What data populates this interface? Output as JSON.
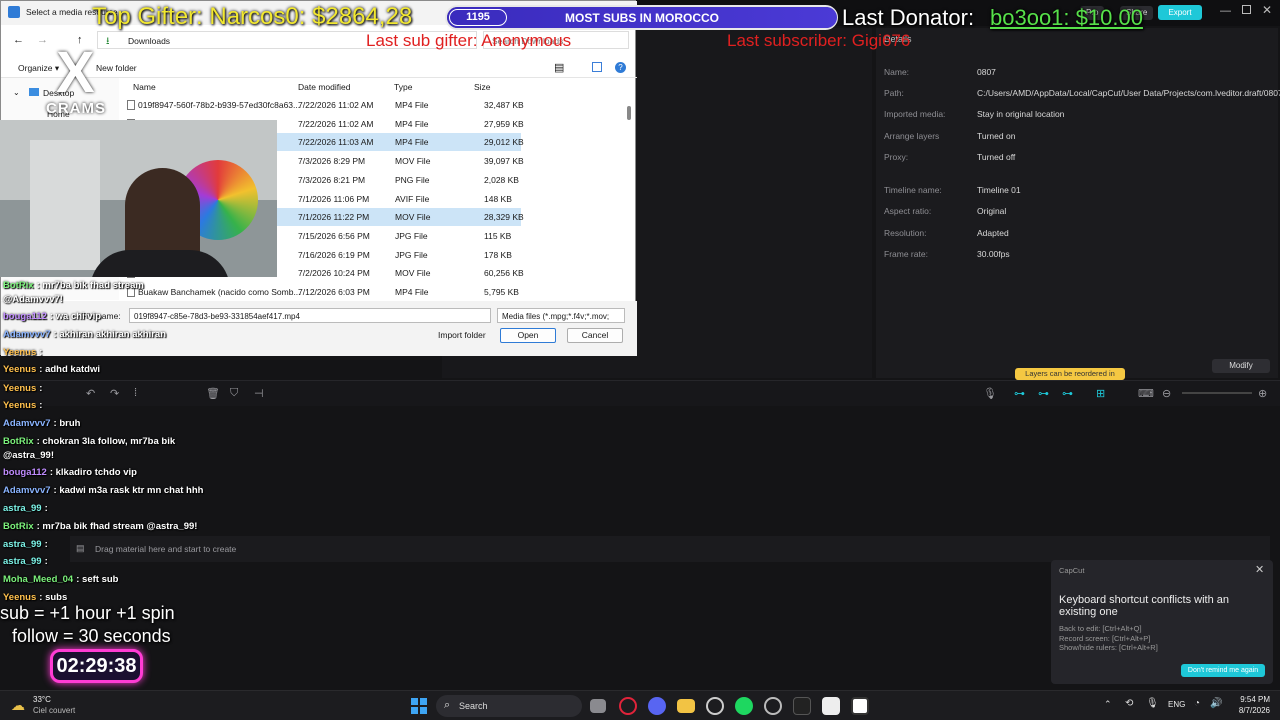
{
  "overlay": {
    "top_gifter": "Top Gifter: Narcos0: $2864,28",
    "goal_count": "1195",
    "goal_text": "MOST SUBS IN MOROCCO",
    "last_donator_label": "Last Donator:",
    "last_donator_value": "bo3oo1: $10.00",
    "last_sub_gifter": "Last sub gifter: Anonymous",
    "last_subscriber": "Last subscriber: Gigi676",
    "rules_line1": "sub  = +1 hour +1 spin",
    "rules_line2": "follow = 30 seconds",
    "timer": "02:29:38",
    "logo_text": "CRAMS"
  },
  "capcut": {
    "pro": "Pro",
    "share": "Share",
    "export": "Export",
    "details": "Details",
    "props": [
      {
        "label": "Name:",
        "value": "0807"
      },
      {
        "label": "Path:",
        "value": "C:/Users/AMD/AppData/Local/CapCut/User Data/Projects/com.lveditor.draft/0807"
      },
      {
        "label": "Imported media:",
        "value": "Stay in original location"
      },
      {
        "label": "Arrange layers",
        "value": "Turned on"
      },
      {
        "label": "Proxy:",
        "value": "Turned off"
      },
      {
        "label": "Timeline name:",
        "value": "Timeline 01"
      },
      {
        "label": "Aspect ratio:",
        "value": "Original"
      },
      {
        "label": "Resolution:",
        "value": "Adapted"
      },
      {
        "label": "Frame rate:",
        "value": "30.00fps"
      }
    ],
    "layers_tip": "Layers can be reordered in",
    "modify": "Modify",
    "drag_hint": "Drag material here and start to create",
    "toast_app": "CapCut",
    "toast_title": "Keyboard shortcut conflicts with an existing one",
    "toast_lines": [
      "Back to edit: [Ctrl+Alt+Q]",
      "Record screen: [Ctrl+Alt+P]",
      "Show/hide rulers: [Ctrl+Alt+R]"
    ],
    "toast_button": "Don't remind me again"
  },
  "dialog": {
    "title": "Select a media resource",
    "breadcrumb": "Downloads",
    "search_placeholder": "Search Downloads",
    "organize": "Organize",
    "new_folder": "New folder",
    "columns": [
      "Name",
      "Date modified",
      "Type",
      "Size"
    ],
    "sidebar": [
      "Desktop",
      "Home"
    ],
    "files": [
      {
        "name": "019f8947-560f-78b2-b939-57ed30fc8a63...",
        "date": "7/22/2026 11:02 AM",
        "type": "MP4 File",
        "size": "32,487 KB",
        "selected": false
      },
      {
        "name": "",
        "date": "7/22/2026 11:02 AM",
        "type": "MP4 File",
        "size": "27,959 KB",
        "selected": false
      },
      {
        "name": "",
        "date": "7/22/2026 11:03 AM",
        "type": "MP4 File",
        "size": "29,012 KB",
        "selected": true
      },
      {
        "name": "",
        "date": "7/3/2026 8:29 PM",
        "type": "MOV File",
        "size": "39,097 KB",
        "selected": false
      },
      {
        "name": "",
        "date": "7/3/2026 8:21 PM",
        "type": "PNG File",
        "size": "2,028 KB",
        "selected": false
      },
      {
        "name": "",
        "date": "7/1/2026 11:06 PM",
        "type": "AVIF File",
        "size": "148 KB",
        "selected": false
      },
      {
        "name": "",
        "date": "7/1/2026 11:22 PM",
        "type": "MOV File",
        "size": "28,329 KB",
        "selected": true
      },
      {
        "name": "",
        "date": "7/15/2026 6:56 PM",
        "type": "JPG File",
        "size": "115 KB",
        "selected": false
      },
      {
        "name": "",
        "date": "7/16/2026 6:19 PM",
        "type": "JPG File",
        "size": "178 KB",
        "selected": false
      },
      {
        "name": "",
        "date": "7/2/2026 10:24 PM",
        "type": "MOV File",
        "size": "60,256 KB",
        "selected": false
      },
      {
        "name": "Buakaw Banchamek (nacido como Somb...",
        "date": "7/12/2026 6:03 PM",
        "type": "MP4 File",
        "size": "5,795 KB",
        "selected": false
      }
    ],
    "filename_label": "File name:",
    "filename_value": "019f8947-c85e-78d3-be93-331854aef417.mp4",
    "filter": "Media files (*.mpg;*.f4v;*.mov;",
    "import_folder": "Import folder",
    "open": "Open",
    "cancel": "Cancel"
  },
  "chat": [
    {
      "user": "BotRix",
      "color": "#7cf27c",
      "msg": ": mr7ba bik fhad stream"
    },
    {
      "user": "",
      "color": "#fff",
      "msg": "@Adamvvv7!"
    },
    {
      "user": "bouga112",
      "color": "#c08cff",
      "msg": ": wa chi vip"
    },
    {
      "user": "Adamvvv7",
      "color": "#8ab4ff",
      "msg": ": akhiran akhiran akhiran"
    },
    {
      "user": "Yeenus",
      "color": "#ffc04d",
      "msg": ":"
    },
    {
      "user": "Yeenus",
      "color": "#ffc04d",
      "msg": ": adhd katdwi"
    },
    {
      "user": "Yeenus",
      "color": "#ffc04d",
      "msg": ":"
    },
    {
      "user": "Yeenus",
      "color": "#ffc04d",
      "msg": ":"
    },
    {
      "user": "Adamvvv7",
      "color": "#8ab4ff",
      "msg": ": bruh"
    },
    {
      "user": "BotRix",
      "color": "#7cf27c",
      "msg": ": chokran 3la follow, mr7ba bik"
    },
    {
      "user": "",
      "color": "#fff",
      "msg": "@astra_99!"
    },
    {
      "user": "bouga112",
      "color": "#c08cff",
      "msg": ": klkadiro tchdo vip"
    },
    {
      "user": "Adamvvv7",
      "color": "#8ab4ff",
      "msg": ": kadwi m3a rask ktr mn chat hhh"
    },
    {
      "user": "astra_99",
      "color": "#7cf2e6",
      "msg": ":"
    },
    {
      "user": "BotRix",
      "color": "#7cf27c",
      "msg": ": mr7ba bik fhad stream @astra_99!"
    },
    {
      "user": "astra_99",
      "color": "#7cf2e6",
      "msg": ":"
    },
    {
      "user": "astra_99",
      "color": "#7cf2e6",
      "msg": ":"
    },
    {
      "user": "Moha_Meed_04",
      "color": "#7cf27c",
      "msg": ": seft sub"
    },
    {
      "user": "Yeenus",
      "color": "#ffc04d",
      "msg": ": subs"
    }
  ],
  "taskbar": {
    "temp": "33°C",
    "weather": "Ciel couvert",
    "search": "Search",
    "lang": "ENG",
    "time": "9:54 PM",
    "date": "8/7/2026"
  }
}
